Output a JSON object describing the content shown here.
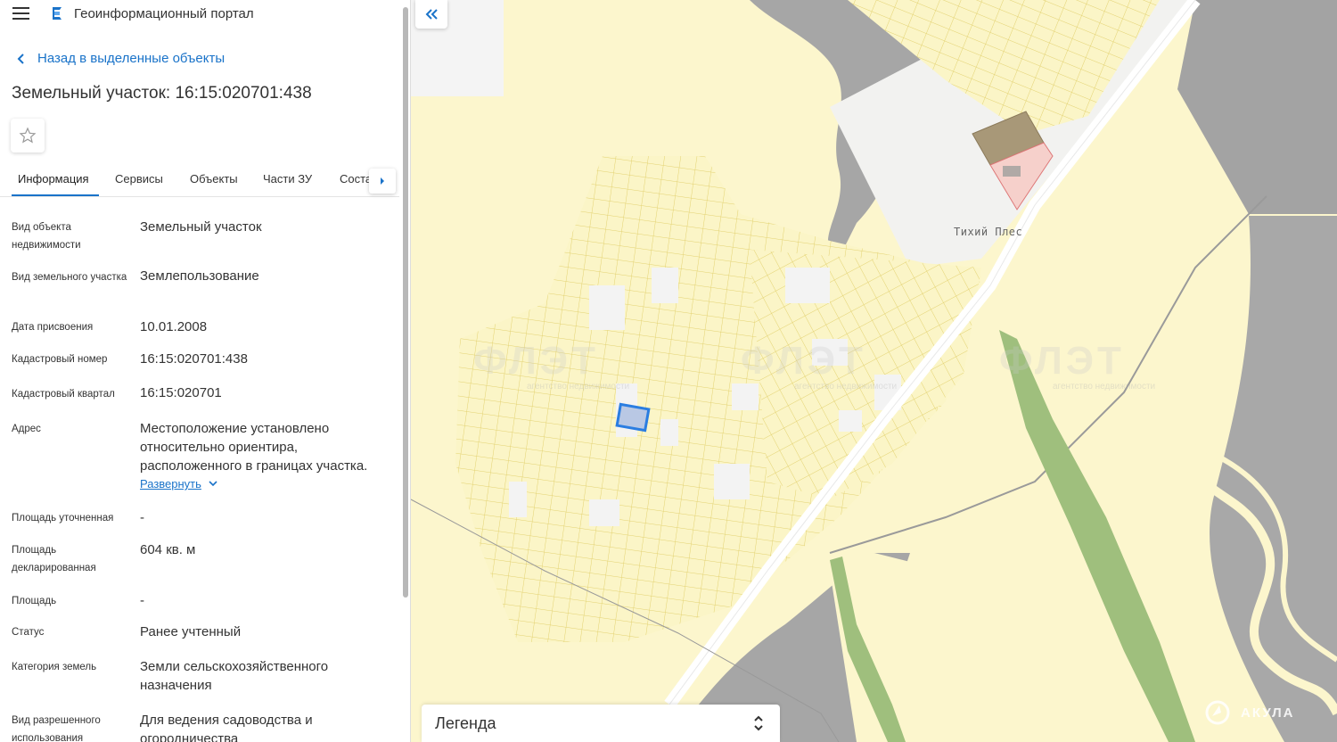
{
  "app": {
    "title": "Геоинформационный портал"
  },
  "nav": {
    "back_label": "Назад в выделенные объекты"
  },
  "object": {
    "title": "Земельный участок: 16:15:020701:438"
  },
  "tabs": [
    {
      "label": "Информация",
      "active": true
    },
    {
      "label": "Сервисы"
    },
    {
      "label": "Объекты"
    },
    {
      "label": "Части ЗУ"
    },
    {
      "label": "Соста"
    }
  ],
  "properties": [
    {
      "label": "Вид объекта недвижимости",
      "value": "Земельный участок"
    },
    {
      "label": "Вид земельного участка",
      "value": "Землепользование"
    },
    {
      "label": "Дата присвоения",
      "value": "10.01.2008"
    },
    {
      "label": "Кадастровый номер",
      "value": "16:15:020701:438"
    },
    {
      "label": "Кадастровый квартал",
      "value": "16:15:020701"
    },
    {
      "label": "Адрес",
      "value": "Местоположение установлено относительно ориентира, расположенного в границах участка."
    },
    {
      "label": "Площадь уточненная",
      "value": "-"
    },
    {
      "label": "Площадь декларированная",
      "value": "604 кв. м"
    },
    {
      "label": "Площадь",
      "value": "-"
    },
    {
      "label": "Статус",
      "value": "Ранее учтенный"
    },
    {
      "label": "Категория земель",
      "value": "Земли сельскохозяйственного назначения"
    },
    {
      "label": "Вид разрешенного использования",
      "value": "Для ведения садоводства и огородничества"
    }
  ],
  "address_expand_label": "Развернуть",
  "map": {
    "place_label": "Тихий Плес",
    "legend_title": "Легенда",
    "watermark_text": "ФЛЭТ",
    "watermark_subtext": "агентство недвижимости",
    "corner_watermark": "АКУЛА"
  },
  "colors": {
    "accent": "#1a73c9",
    "parcel_fill": "#fbf5c7",
    "parcel_stroke": "#e6d77a",
    "selected_parcel": "#2a7de1",
    "water": "#9e9e9e",
    "green_strip": "#9dbf7a"
  }
}
